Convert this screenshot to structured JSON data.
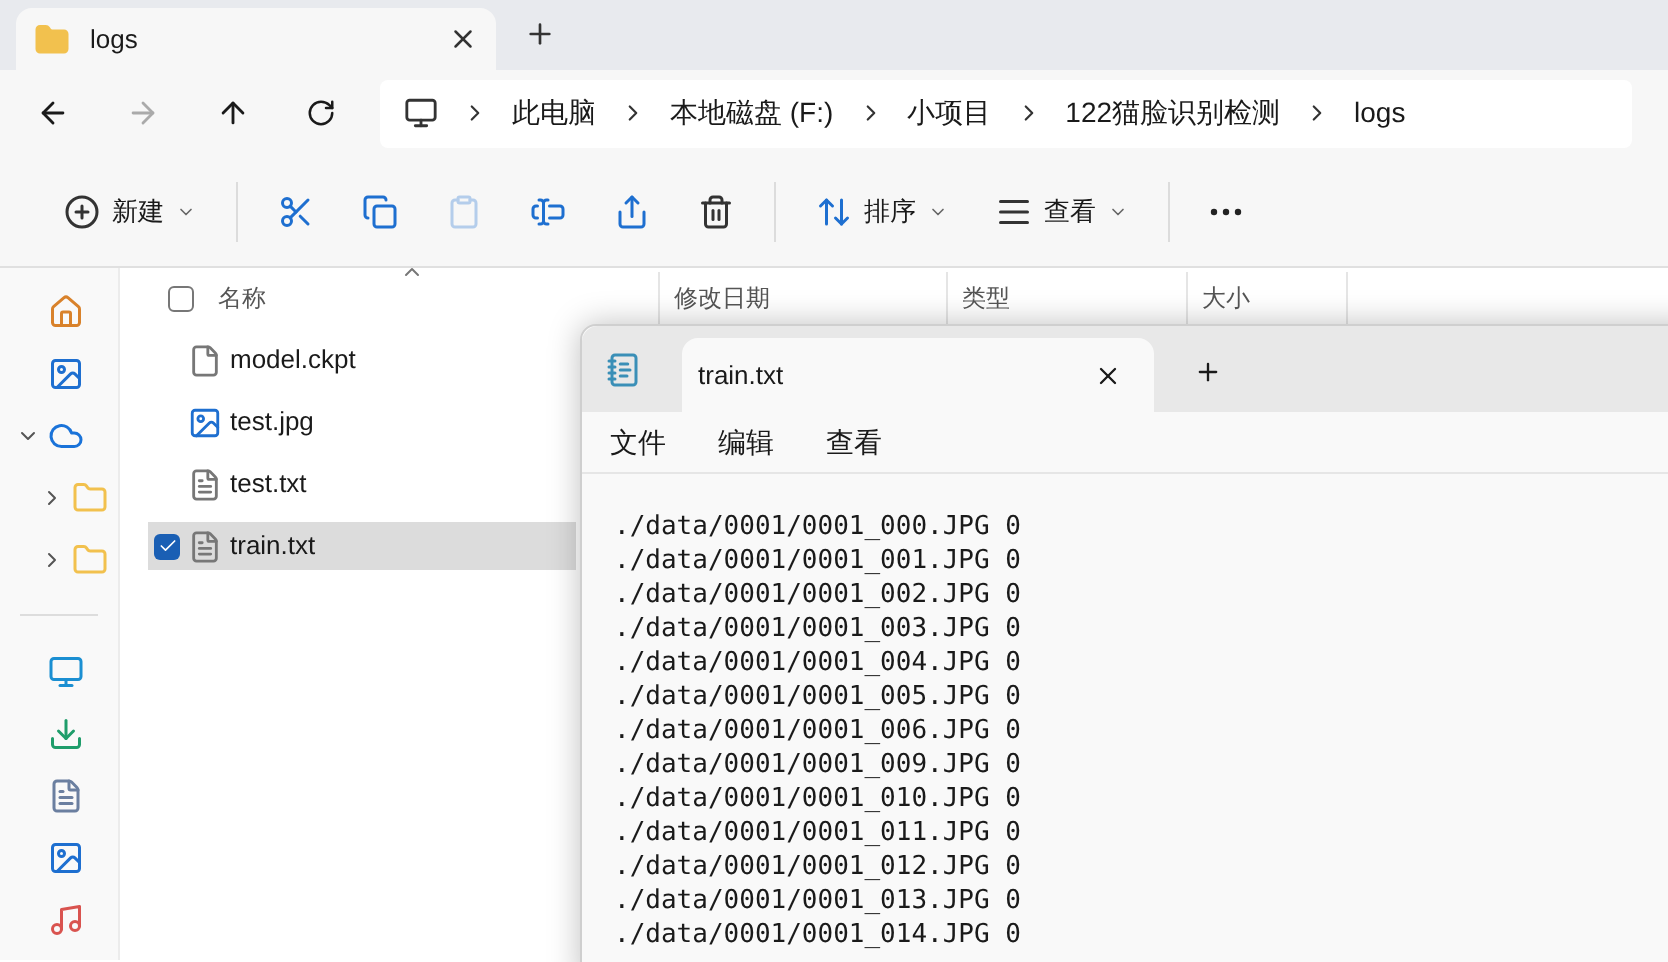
{
  "explorer": {
    "tabs": [
      {
        "label": "logs",
        "selected": true
      }
    ],
    "breadcrumbs": [
      "此电脑",
      "本地磁盘 (F:)",
      "小项目",
      "122猫脸识别检测",
      "logs"
    ],
    "toolbar": [
      {
        "kind": "new",
        "label": "新建"
      },
      {
        "kind": "cut"
      },
      {
        "kind": "copy"
      },
      {
        "kind": "paste",
        "disabled": true
      },
      {
        "kind": "rename"
      },
      {
        "kind": "share"
      },
      {
        "kind": "delete"
      },
      {
        "kind": "sort",
        "label": "排序"
      },
      {
        "kind": "view",
        "label": "查看"
      },
      {
        "kind": "more"
      }
    ],
    "sidebar": [
      {
        "kind": "home"
      },
      {
        "kind": "gallery"
      },
      {
        "kind": "cloud",
        "expanded": true,
        "children": [
          {
            "kind": "folder",
            "expanded": false
          },
          {
            "kind": "folder",
            "expanded": false
          }
        ]
      },
      {
        "kind": "desktop"
      },
      {
        "kind": "download"
      },
      {
        "kind": "documents"
      },
      {
        "kind": "pictures"
      },
      {
        "kind": "music"
      }
    ],
    "select_all_checked": false,
    "columns": [
      "名称",
      "修改日期",
      "类型",
      "大小"
    ],
    "files": [
      {
        "name": "model.ckpt",
        "kind": "file",
        "selected": false
      },
      {
        "name": "test.jpg",
        "kind": "image",
        "selected": false
      },
      {
        "name": "test.txt",
        "kind": "text",
        "selected": false
      },
      {
        "name": "train.txt",
        "kind": "text",
        "selected": true
      }
    ]
  },
  "notepad": {
    "tab": "train.txt",
    "menu": [
      "文件",
      "编辑",
      "查看"
    ],
    "lines": [
      "./data/0001/0001_000.JPG 0",
      "./data/0001/0001_001.JPG 0",
      "./data/0001/0001_002.JPG 0",
      "./data/0001/0001_003.JPG 0",
      "./data/0001/0001_004.JPG 0",
      "./data/0001/0001_005.JPG 0",
      "./data/0001/0001_006.JPG 0",
      "./data/0001/0001_009.JPG 0",
      "./data/0001/0001_010.JPG 0",
      "./data/0001/0001_011.JPG 0",
      "./data/0001/0001_012.JPG 0",
      "./data/0001/0001_013.JPG 0",
      "./data/0001/0001_014.JPG 0"
    ]
  }
}
